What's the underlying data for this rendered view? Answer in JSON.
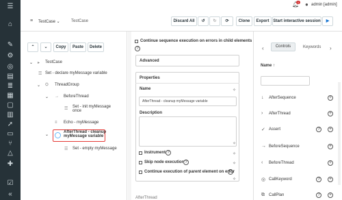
{
  "header": {
    "user_label": "admin [admin]",
    "notif_count": "1"
  },
  "toolbar": {
    "testcase_selector": "TestCase",
    "testcase_name": "TestCase",
    "discard_all": "Discard All",
    "clone": "Clone",
    "export": "Export",
    "start_session": "Start interactive session"
  },
  "tree_toolbar": {
    "copy": "Copy",
    "paste": "Paste",
    "delete": "Delete"
  },
  "tree": {
    "root": "TestCase",
    "set_declare": "Set - declare myMessage variable",
    "thread_group": "ThreadGroup",
    "before_thread": "BeforeThread",
    "set_init_1": "Set - init myMessage",
    "set_init_2": "once",
    "echo": "Echo - myMessage",
    "after_thread_1": "AfterThread - cleanup",
    "after_thread_2": "myMessage variable",
    "set_empty": "Set - empty myMessage"
  },
  "properties_panel": {
    "continue_seq_1": "Continue sequence execution on errors in child elements",
    "advanced": "Advanced",
    "properties": "Properties",
    "name_label": "Name",
    "name_value": "AfterThread - cleanup myMessage variable",
    "description_label": "Description",
    "instrument": "Instrument",
    "skip_node": "Skip node execution",
    "continue_parent": "Continue execution of parent element on error",
    "footer": "AfterThread"
  },
  "controls_panel": {
    "tab_controls": "Controls",
    "tab_keywords": "Keywords",
    "name_header": "Name",
    "items": [
      "AfterSequence",
      "AfterThread",
      "Assert",
      "BeforeSequence",
      "BeforeThread",
      "CallKeyword",
      "CallPlan"
    ]
  }
}
